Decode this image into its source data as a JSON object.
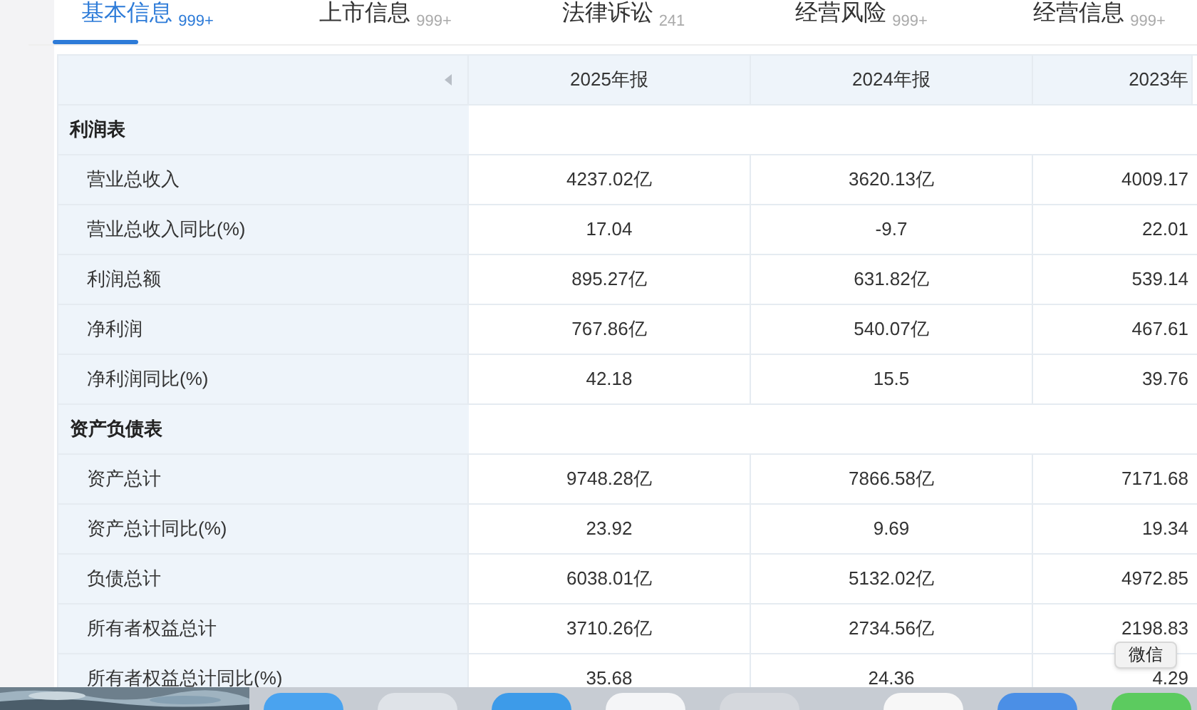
{
  "tabs": [
    {
      "label": "基本信息",
      "count": "999+",
      "selected": true
    },
    {
      "label": "上市信息",
      "count": "999+",
      "selected": false
    },
    {
      "label": "法律诉讼",
      "count": "241",
      "selected": false
    },
    {
      "label": "经营风险",
      "count": "999+",
      "selected": false
    },
    {
      "label": "经营信息",
      "count": "999+",
      "selected": false
    }
  ],
  "table": {
    "columns": [
      "2025年报",
      "2024年报",
      "2023年"
    ],
    "rows": [
      {
        "kind": "section",
        "label": "利润表"
      },
      {
        "kind": "row",
        "label": "营业总收入",
        "values": [
          "4237.02亿",
          "3620.13亿",
          "4009.17"
        ]
      },
      {
        "kind": "row",
        "label": "营业总收入同比(%)",
        "values": [
          "17.04",
          "-9.7",
          "22.01"
        ]
      },
      {
        "kind": "row",
        "label": "利润总额",
        "values": [
          "895.27亿",
          "631.82亿",
          "539.14"
        ]
      },
      {
        "kind": "row",
        "label": "净利润",
        "values": [
          "767.86亿",
          "540.07亿",
          "467.61"
        ]
      },
      {
        "kind": "row",
        "label": "净利润同比(%)",
        "values": [
          "42.18",
          "15.5",
          "39.76"
        ]
      },
      {
        "kind": "section",
        "label": "资产负债表"
      },
      {
        "kind": "row",
        "label": "资产总计",
        "values": [
          "9748.28亿",
          "7866.58亿",
          "7171.68"
        ]
      },
      {
        "kind": "row",
        "label": "资产总计同比(%)",
        "values": [
          "23.92",
          "9.69",
          "19.34"
        ]
      },
      {
        "kind": "row",
        "label": "负债总计",
        "values": [
          "6038.01亿",
          "5132.02亿",
          "4972.85"
        ]
      },
      {
        "kind": "row",
        "label": "所有者权益总计",
        "values": [
          "3710.26亿",
          "2734.56亿",
          "2198.83"
        ]
      },
      {
        "kind": "row",
        "label": "所有者权益总计同比(%)",
        "values": [
          "35.68",
          "24.36",
          "4.29"
        ]
      }
    ]
  },
  "tooltip": "微信"
}
